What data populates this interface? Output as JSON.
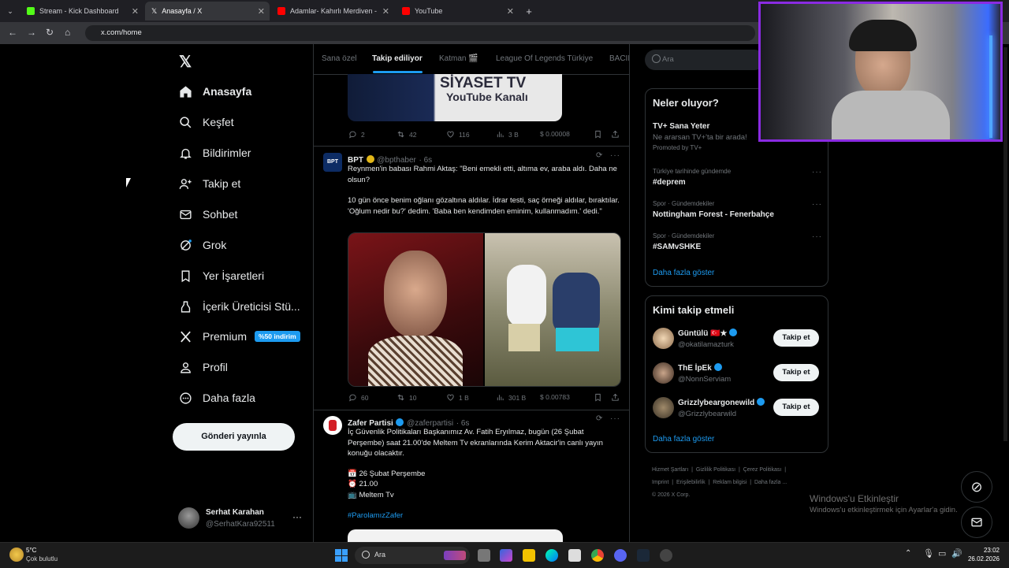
{
  "browser": {
    "tabs": [
      {
        "label": "Stream - Kick Dashboard",
        "color": "#53fc18"
      },
      {
        "label": "Anasayfa / X",
        "color": "#ffffff"
      },
      {
        "label": "Adamlar- Kahırlı Merdiven - Yo",
        "color": "#ff0000"
      },
      {
        "label": "YouTube",
        "color": "#ff0000"
      }
    ],
    "url": "x.com/home"
  },
  "nav": {
    "items": [
      {
        "label": "Anasayfa",
        "icon": "home-icon"
      },
      {
        "label": "Keşfet",
        "icon": "search-icon"
      },
      {
        "label": "Bildirimler",
        "icon": "bell-icon"
      },
      {
        "label": "Takip et",
        "icon": "person-plus-icon"
      },
      {
        "label": "Sohbet",
        "icon": "mail-icon"
      },
      {
        "label": "Grok",
        "icon": "grok-icon"
      },
      {
        "label": "Yer İşaretleri",
        "icon": "bookmark-icon"
      },
      {
        "label": "İçerik Üreticisi Stü...",
        "icon": "creator-icon"
      },
      {
        "label": "Premium",
        "icon": "x-logo-icon"
      },
      {
        "label": "Profil",
        "icon": "person-icon"
      },
      {
        "label": "Daha fazla",
        "icon": "more-circle-icon"
      }
    ],
    "premium_badge": "%50 indirim",
    "post_button": "Gönderi yayınla",
    "account": {
      "name": "Serhat Karahan",
      "handle": "@SerhatKara92511"
    }
  },
  "feed": {
    "tabs": [
      "Sana özel",
      "Takip ediliyor",
      "Katman 🎬",
      "League Of Legends Türkiye",
      "BACII"
    ],
    "top_banner": {
      "line1": "SİYASET TV",
      "line2": "YouTube Kanalı"
    },
    "top_actions": {
      "replies": "2",
      "reposts": "42",
      "likes": "116",
      "views": "3 B",
      "tip": "$ 0.00008"
    },
    "post1": {
      "name": "BPT",
      "handle": "@bpthaber",
      "time": "· 6s",
      "avatar_text": "BPT",
      "text1": "Reynmen'in babası Rahmi Aktaş: \"Beni emekli etti, altıma ev, araba aldı. Daha ne olsun?",
      "text2": "10 gün önce benim oğlanı gözaltına aldılar. İdrar testi, saç örneği aldılar, bıraktılar. 'Oğlum nedir bu?' dedim. 'Baba ben kendimden eminim, kullanmadım.' dedi.\"",
      "actions": {
        "replies": "60",
        "reposts": "10",
        "likes": "1 B",
        "views": "301 B",
        "tip": "$ 0.00783"
      }
    },
    "post2": {
      "name": "Zafer Partisi",
      "handle": "@zaferpartisi",
      "time": "· 6s",
      "text1": "İç Güvenlik Politikaları Başkanımız Av. Fatih Eryılmaz, bugün (26 Şubat Perşembe) saat 21.00'de Meltem Tv ekranlarında Kerim Aktacir'in canlı yayın konuğu olacaktır.",
      "line_date": "📅 26 Şubat Perşembe",
      "line_time": "⏰ 21.00",
      "line_tv": "📺 Meltem Tv",
      "hashtag": "#ParolamızZafer"
    }
  },
  "right": {
    "search_placeholder": "Ara",
    "trends_title": "Neler oluyor?",
    "promo": {
      "title": "TV+ Sana Yeter",
      "sub": "Ne ararsan TV+'ta bir arada!",
      "promoted": "Promoted by TV+"
    },
    "trends": [
      {
        "context": "Türkiye tarihinde gündemde",
        "name": "#deprem"
      },
      {
        "context": "Spor · Gündemdekiler",
        "name": "Nottingham Forest - Fenerbahçe"
      },
      {
        "context": "Spor · Gündemdekiler",
        "name": "#SAMvSHKE"
      }
    ],
    "show_more": "Daha fazla göster",
    "follow_title": "Kimi takip etmeli",
    "follow": [
      {
        "name": "Güntülü 🇹🇷★",
        "handle": "@okatilamazturk"
      },
      {
        "name": "ThE İpEk",
        "handle": "@NonnServiam"
      },
      {
        "name": "Grizzlybeargonewild",
        "handle": "@Grizzlybearwild"
      }
    ],
    "follow_button": "Takip et",
    "show_more2": "Daha fazla göster",
    "footer": {
      "row1": [
        "Hizmet Şartları",
        "Gizlilik Politikası",
        "Çerez Politikası"
      ],
      "row2": [
        "Imprint",
        "Erişilebilirlik",
        "Reklam bilgisi",
        "Daha fazla ..."
      ],
      "copyright": "© 2026 X Corp."
    }
  },
  "watermark": {
    "line1": "Windows'u Etkinleştir",
    "line2": "Windows'u etkinleştirmek için Ayarlar'a gidin."
  },
  "taskbar": {
    "weather_temp": "5°C",
    "weather_desc": "Çok bulutlu",
    "search": "Ara",
    "time": "23:02",
    "date": "26.02.2026"
  }
}
